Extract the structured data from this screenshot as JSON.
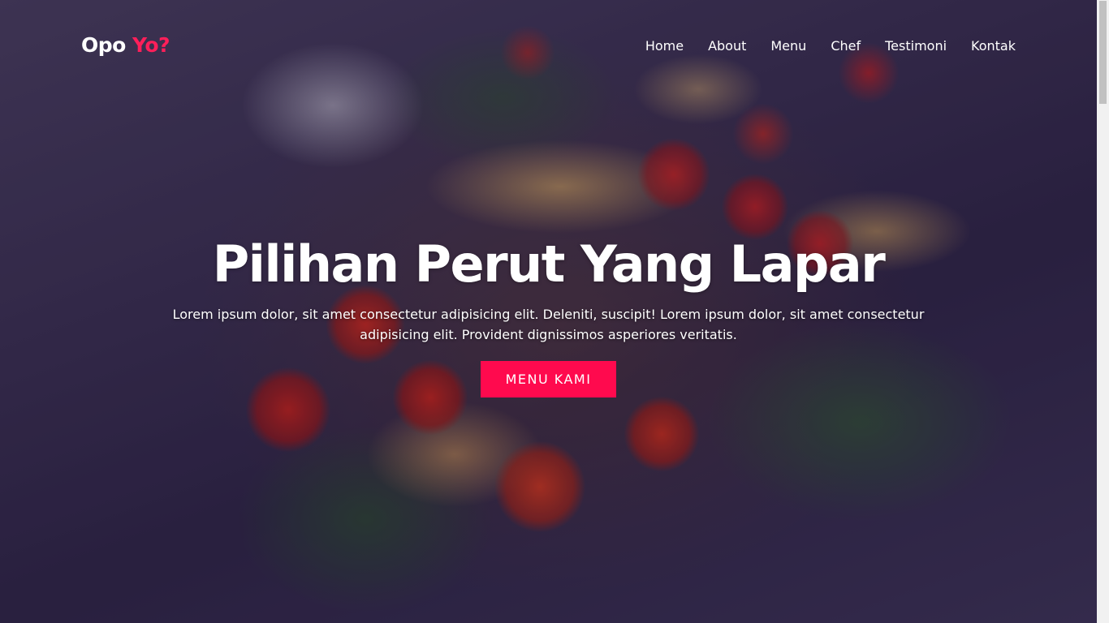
{
  "brand": {
    "name_primary": "Opo",
    "name_accent": "Yo?"
  },
  "nav": {
    "items": [
      {
        "label": "Home"
      },
      {
        "label": "About"
      },
      {
        "label": "Menu"
      },
      {
        "label": "Chef"
      },
      {
        "label": "Testimoni"
      },
      {
        "label": "Kontak"
      }
    ]
  },
  "hero": {
    "title": "Pilihan Perut Yang Lapar",
    "text": "Lorem ipsum dolor, sit amet consectetur adipisicing elit. Deleniti, suscipit! Lorem ipsum dolor, sit amet consectetur adipisicing elit. Provident dignissimos asperiores veritatis.",
    "cta_label": "MENU KAMI",
    "background_icon": "food-photo-pasta-tomatoes"
  },
  "colors": {
    "accent": "#ff0a4e",
    "text": "#ffffff"
  }
}
